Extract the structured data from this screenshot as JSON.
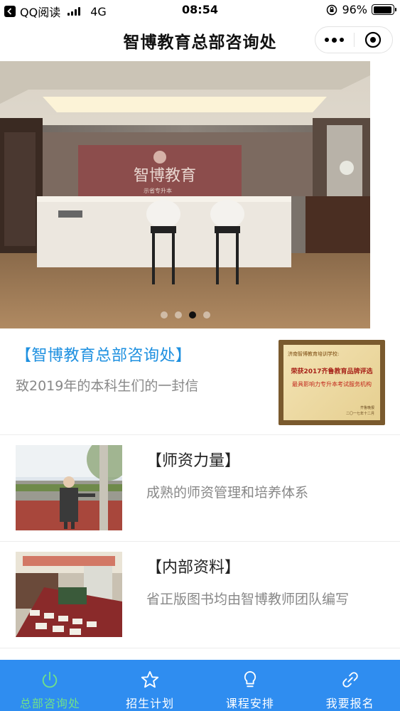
{
  "status_bar": {
    "carrier": "QQ阅读",
    "network": "4G",
    "time": "08:54",
    "battery": "96%",
    "battery_level": 0.96
  },
  "nav": {
    "title": "智博教育总部咨询处",
    "more_icon": "more-dots-icon",
    "close_icon": "target-circle-icon"
  },
  "banner": {
    "sign_text": "智博教育",
    "sign_subtext": "示省专升本",
    "pages": 4,
    "active_page": 3
  },
  "intro": {
    "title": "【智博教育总部咨询处】",
    "subtitle": "致2019年的本科生们的一封信",
    "certificate": {
      "line1": "济南智博教育培训学校:",
      "line2": "荣获2017齐鲁教育品牌评选",
      "line3": "最具影响力专升本考试服务机构",
      "line4": "齐鲁晚报",
      "line5": "二〇一七年十二月"
    }
  },
  "cards": [
    {
      "title": "【师资力量】",
      "subtitle": "成熟的师资管理和培养体系"
    },
    {
      "title": "【内部资料】",
      "subtitle": "省正版图书均由智博教师团队编写"
    }
  ],
  "tabbar": {
    "items": [
      {
        "label": "总部咨询处",
        "icon": "power-icon",
        "active": true
      },
      {
        "label": "招生计划",
        "icon": "star-icon",
        "active": false
      },
      {
        "label": "课程安排",
        "icon": "lightbulb-icon",
        "active": false
      },
      {
        "label": "我要报名",
        "icon": "link-icon",
        "active": false
      }
    ]
  },
  "colors": {
    "accent": "#1e90e0",
    "tabbar_bg": "#2f8df0",
    "tab_active": "#6fe08a"
  }
}
